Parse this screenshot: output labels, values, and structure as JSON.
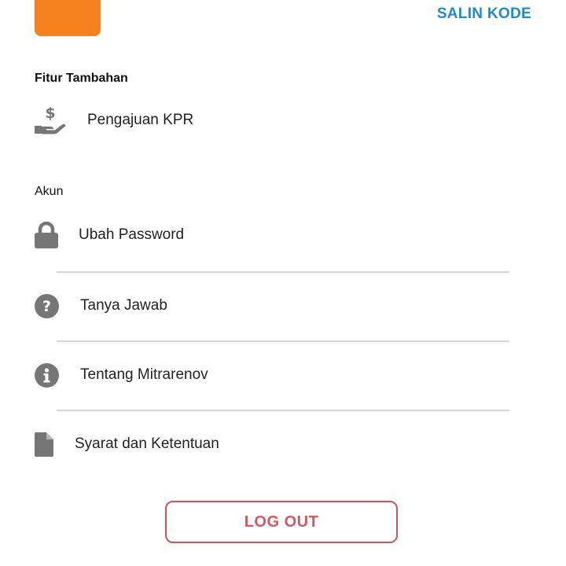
{
  "header": {
    "copy_code_label": "SALIN KODE",
    "accent_color": "#f5821f",
    "link_color": "#1f8ad2"
  },
  "features": {
    "title": "Fitur Tambahan",
    "items": [
      {
        "label": "Pengajuan KPR",
        "icon": "hand-money-icon"
      }
    ]
  },
  "account": {
    "title": "Akun",
    "items": [
      {
        "label": "Ubah Password",
        "icon": "lock-icon"
      },
      {
        "label": "Tanya Jawab",
        "icon": "question-circle-icon"
      },
      {
        "label": "Tentang Mitrarenov",
        "icon": "info-circle-icon"
      },
      {
        "label": "Syarat dan Ketentuan",
        "icon": "document-icon"
      }
    ]
  },
  "logout": {
    "label": "LOG OUT",
    "color": "#cf5a5f"
  }
}
